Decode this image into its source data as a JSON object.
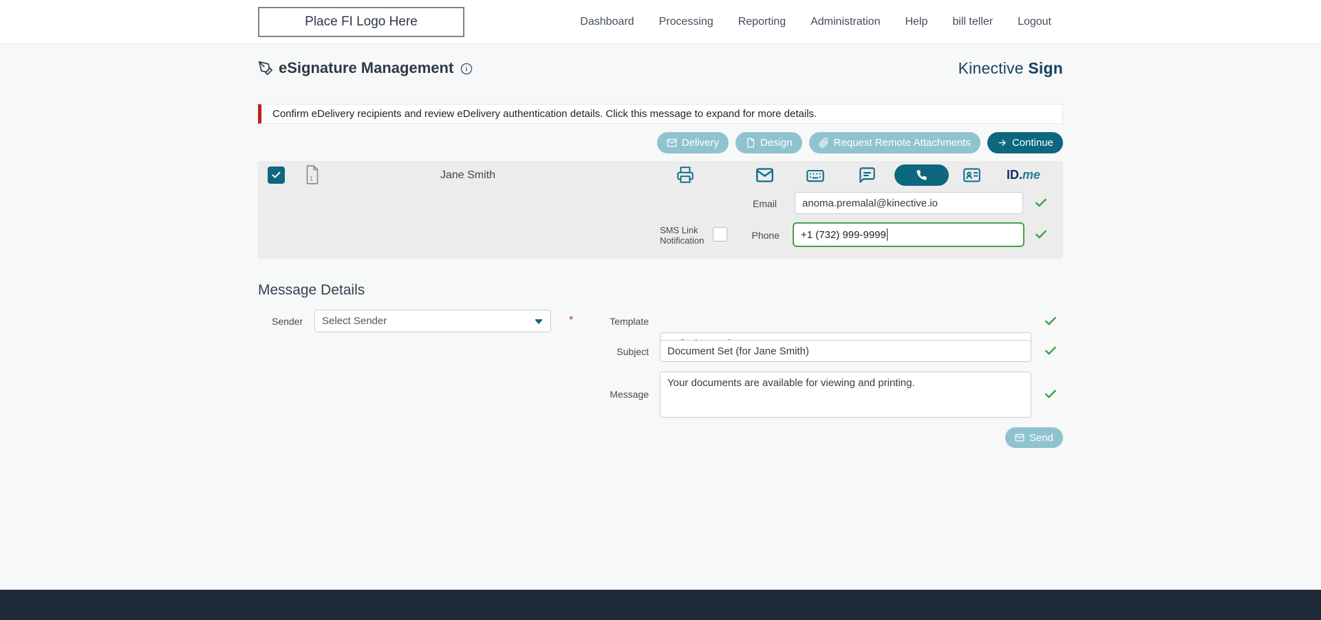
{
  "nav": {
    "logo_text": "Place FI Logo Here",
    "items": [
      {
        "label": "Dashboard"
      },
      {
        "label": "Processing"
      },
      {
        "label": "Reporting"
      },
      {
        "label": "Administration"
      },
      {
        "label": "Help"
      },
      {
        "label": "bill teller"
      },
      {
        "label": "Logout"
      }
    ]
  },
  "header": {
    "title": "eSignature Management",
    "brand_name": "Kinective",
    "brand_product": "Sign"
  },
  "alert": {
    "text": "Confirm eDelivery recipients and review eDelivery authentication details. Click this message to expand for more details."
  },
  "toolbar": {
    "delivery": "Delivery",
    "design": "Design",
    "request_remote_attachments": "Request Remote Attachments",
    "continue": "Continue"
  },
  "recipient": {
    "name": "Jane Smith",
    "doc_count": "1",
    "idme_id": "ID.",
    "idme_me": "me",
    "email_label": "Email",
    "email_value": "anoma.premalal@kinective.io",
    "sms_label": "SMS Link Notification",
    "phone_label": "Phone",
    "phone_value": "+1 (732) 999-9999"
  },
  "message_details": {
    "heading": "Message Details",
    "sender_label": "Sender",
    "sender_placeholder": "Select Sender",
    "required_marker": "*",
    "template_label": "Template",
    "template_value": "Default Template",
    "subject_label": "Subject",
    "subject_value": "Document Set (for Jane Smith)",
    "message_label": "Message",
    "message_value": "Your documents are available for viewing and printing.",
    "send": "Send"
  },
  "colors": {
    "accent_dark_teal": "#0d677f",
    "accent_muted_teal": "#8fc3d0",
    "success_green": "#43a047",
    "alert_red": "#b9231f",
    "brand_navy": "#15455e",
    "footer": "#1f2b38"
  }
}
